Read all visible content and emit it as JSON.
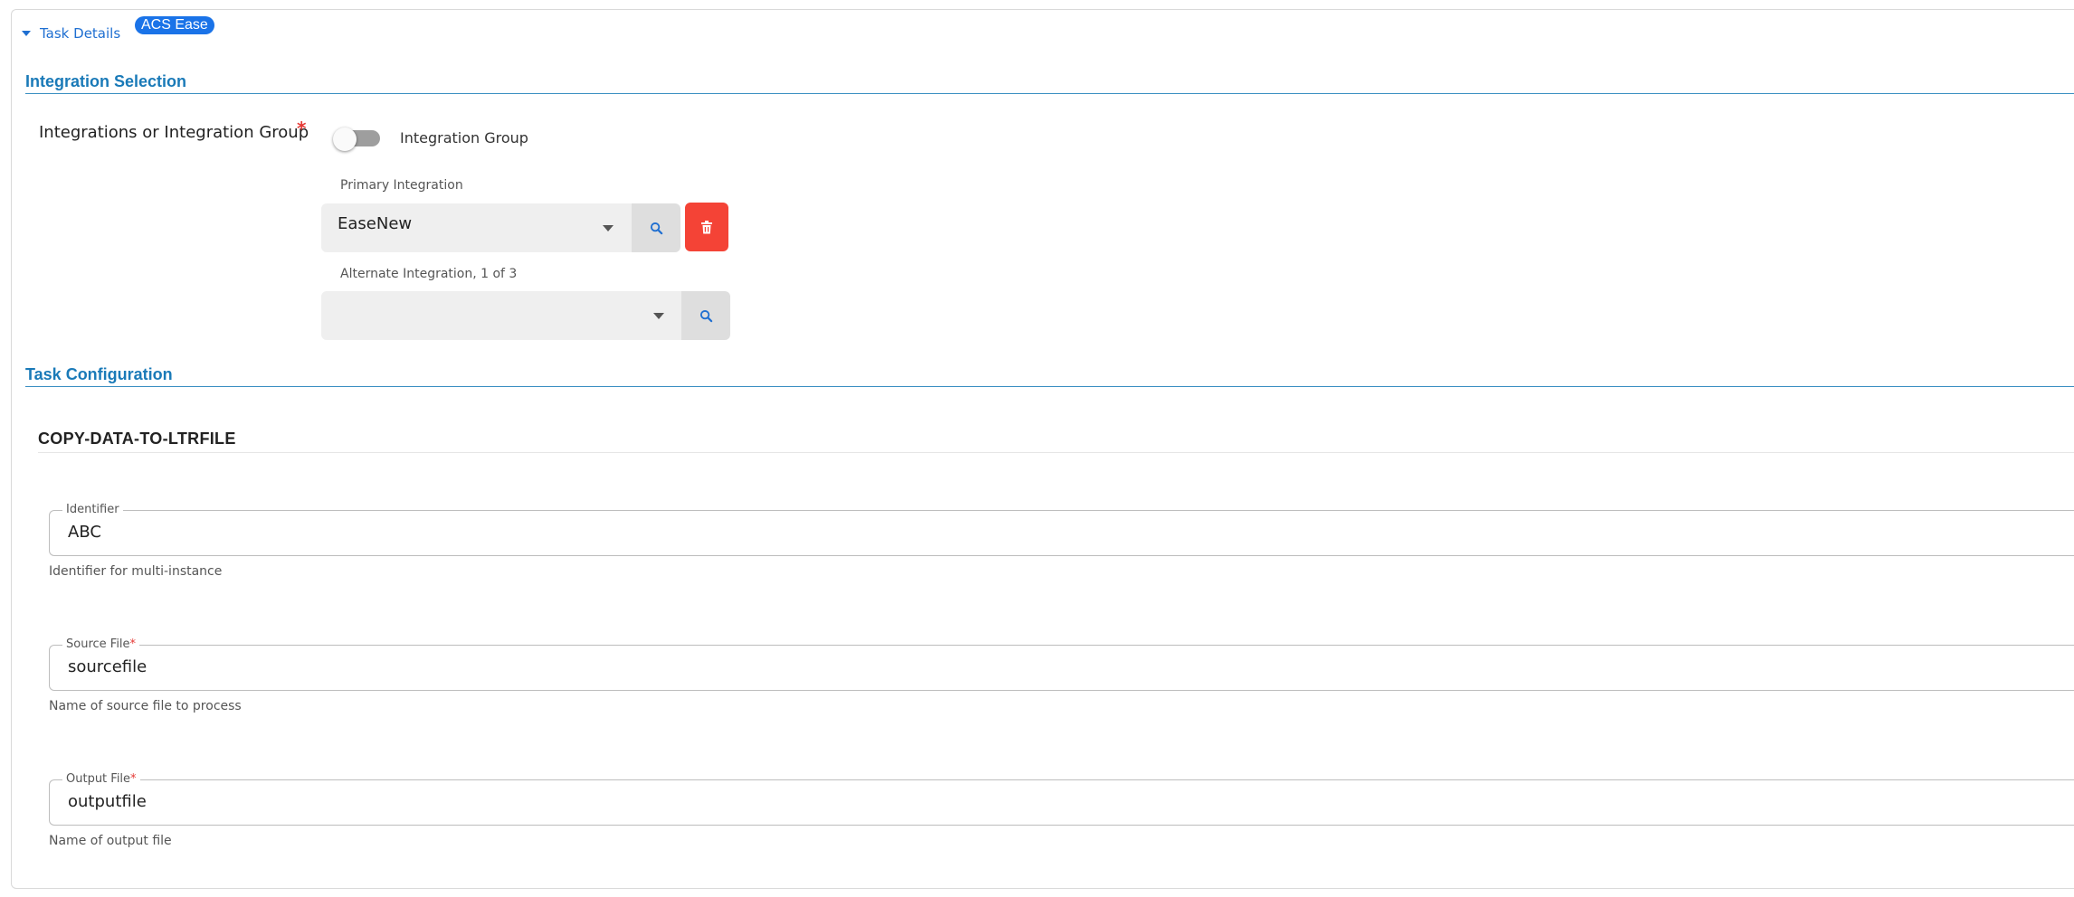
{
  "header": {
    "title": "Task Details",
    "badge": "ACS Ease"
  },
  "integration_selection": {
    "title": "Integration Selection",
    "field_label": "Integrations or Integration Group",
    "required_mark": "*",
    "toggle_label": "Integration Group",
    "toggle_on": false,
    "primary": {
      "label": "Primary Integration",
      "value": "EaseNew"
    },
    "alternate": {
      "label": "Alternate Integration, 1 of 3",
      "value": ""
    }
  },
  "task_configuration": {
    "title": "Task Configuration",
    "task_name": "COPY-DATA-TO-LTRFILE",
    "fields": {
      "identifier": {
        "label": "Identifier",
        "value": "ABC",
        "helper": "Identifier for multi-instance"
      },
      "source_file": {
        "label": "Source File",
        "required": "*",
        "value": "sourcefile",
        "helper": "Name of source file to process"
      },
      "output_file": {
        "label": "Output File",
        "required": "*",
        "value": "outputfile",
        "helper": "Name of output file"
      }
    }
  },
  "colors": {
    "accent": "#1f6fd1",
    "section": "#1a7ab8",
    "delete": "#f44336",
    "required": "#e53935"
  },
  "icons": [
    "caret-down-icon",
    "search-icon",
    "trash-icon",
    "chevron-down-icon"
  ]
}
